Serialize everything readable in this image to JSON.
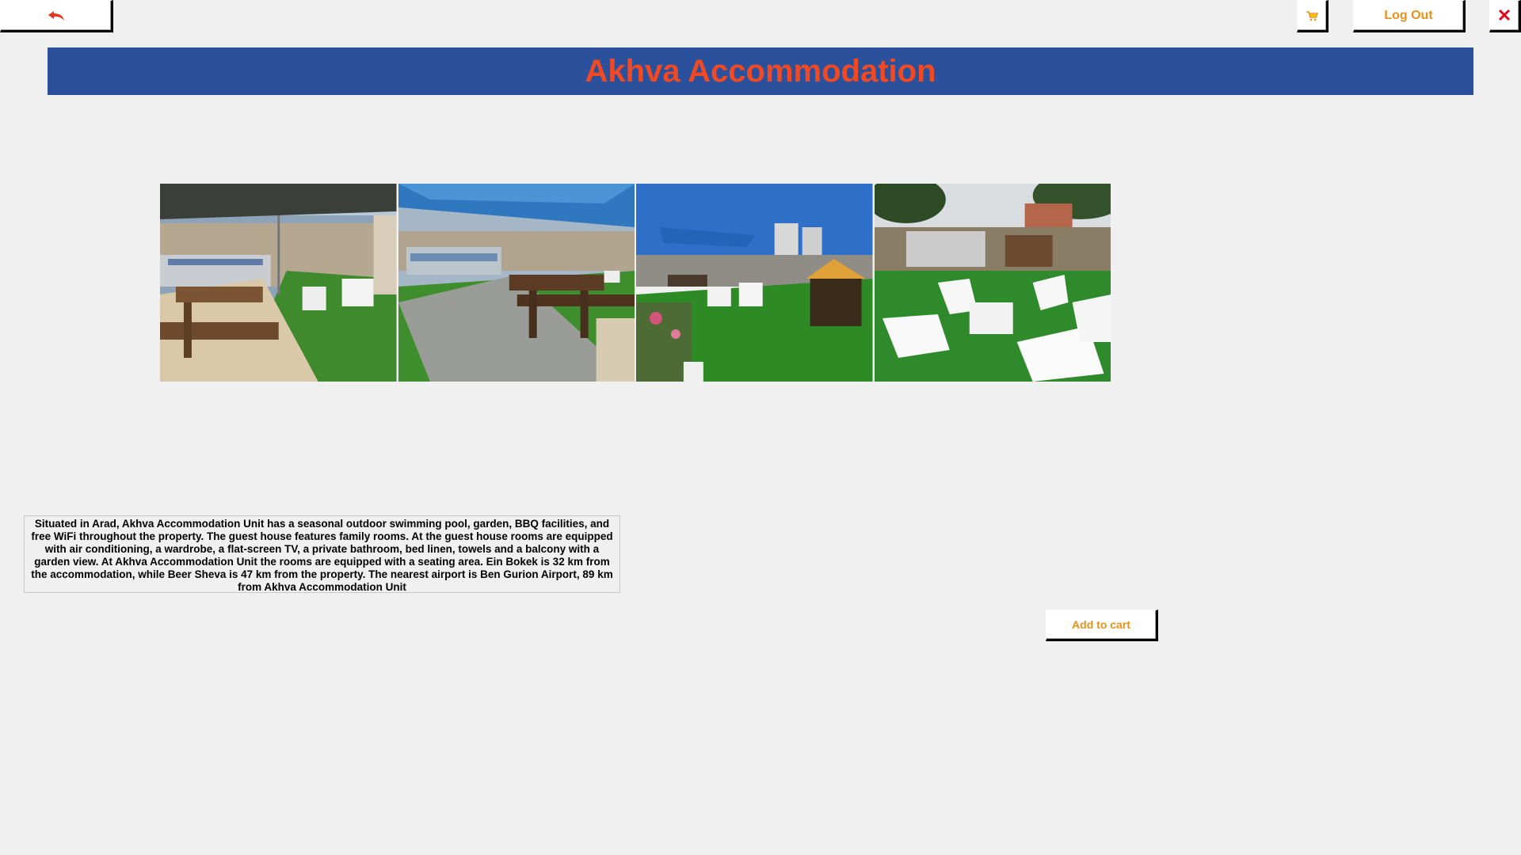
{
  "toolbar": {
    "back_icon": "back-arrow-icon",
    "cart_icon": "shopping-cart-icon",
    "logout_label": "Log Out",
    "close_label": "✕"
  },
  "header": {
    "title": "Akhva Accommodation"
  },
  "gallery": {
    "photos": [
      "garden-pool-gazebo-photo",
      "picnic-table-shade-photo",
      "yard-playhouse-photo",
      "lawn-lounge-chairs-photo"
    ]
  },
  "description": {
    "text": "Situated in Arad, Akhva Accommodation Unit has a seasonal outdoor swimming pool, garden, BBQ facilities, and free WiFi throughout the property. The guest house features family rooms. At the guest house rooms are equipped with air conditioning, a wardrobe, a flat-screen TV, a private bathroom, bed linen, towels and a balcony with a garden view. At Akhva Accommodation Unit the rooms are equipped with a seating area. Ein Bokek is 32 km from the accommodation, while Beer Sheva is 47 km from the property. The nearest airport is Ben Gurion Airport, 89 km from Akhva Accommodation Unit"
  },
  "actions": {
    "add_to_cart_label": "Add to cart"
  },
  "colors": {
    "header_bg": "#2b519c",
    "title": "#f04a25",
    "button_text": "#e8911a",
    "close": "#e8001c",
    "background": "#f0f0f0"
  }
}
